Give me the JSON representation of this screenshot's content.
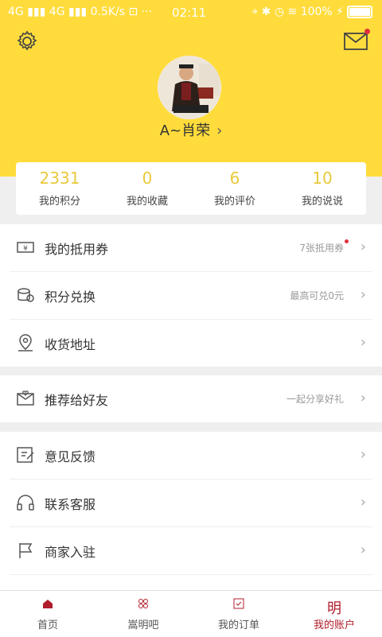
{
  "status_bar": {
    "left": "4G",
    "signal1": "4G",
    "speed": "0.5K/s",
    "time": "02:11",
    "battery": "100%"
  },
  "profile": {
    "username": "A~肖荣"
  },
  "stats": [
    {
      "value": "2331",
      "label": "我的积分"
    },
    {
      "value": "0",
      "label": "我的收藏"
    },
    {
      "value": "6",
      "label": "我的评价"
    },
    {
      "value": "10",
      "label": "我的说说"
    }
  ],
  "group1": [
    {
      "label": "我的抵用券",
      "hint": "7张抵用券"
    },
    {
      "label": "积分兑换",
      "hint": "最高可兑0元"
    },
    {
      "label": "收货地址",
      "hint": ""
    }
  ],
  "group2": [
    {
      "label": "推荐给好友",
      "hint": "一起分享好礼"
    }
  ],
  "group3": [
    {
      "label": "意见反馈",
      "hint": ""
    },
    {
      "label": "联系客服",
      "hint": ""
    },
    {
      "label": "商家入驻",
      "hint": ""
    }
  ],
  "tabs": [
    {
      "label": "首页"
    },
    {
      "label": "嵩明吧"
    },
    {
      "label": "我的订单"
    },
    {
      "label": "我的账户",
      "icon_text": "明"
    }
  ],
  "colors": {
    "header": "#ffdc3c",
    "stat_value": "#e9c93b",
    "active_tab": "#b01c2b"
  }
}
